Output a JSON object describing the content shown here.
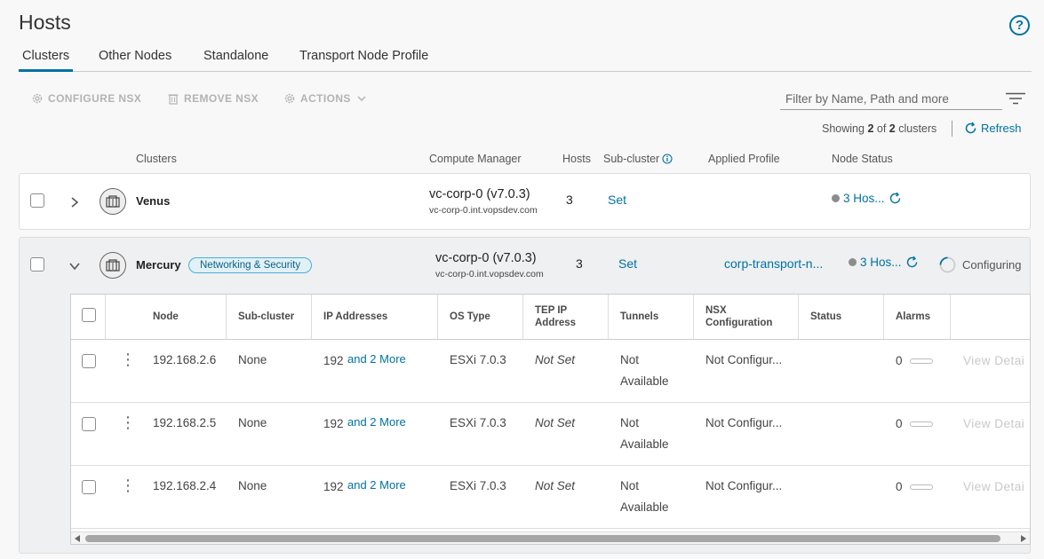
{
  "header": {
    "title": "Hosts",
    "help_label": "?"
  },
  "tabs": [
    {
      "label": "Clusters",
      "active": true
    },
    {
      "label": "Other Nodes"
    },
    {
      "label": "Standalone"
    },
    {
      "label": "Transport Node Profile"
    }
  ],
  "toolbar": {
    "configure": "CONFIGURE NSX",
    "remove": "REMOVE NSX",
    "actions": "ACTIONS"
  },
  "filter": {
    "placeholder": "Filter by Name, Path and more"
  },
  "summary": {
    "prefix": "Showing",
    "shown": "2",
    "of": "of",
    "total": "2",
    "suffix": "clusters",
    "refresh": "Refresh"
  },
  "columns": {
    "clusters": "Clusters",
    "compute_manager": "Compute Manager",
    "hosts": "Hosts",
    "sub_cluster": "Sub-cluster",
    "applied_profile": "Applied Profile",
    "node_status": "Node Status"
  },
  "clusters": [
    {
      "name": "Venus",
      "cm_name": "vc-corp-0 (v7.0.3)",
      "cm_host": "vc-corp-0.int.vopsdev.com",
      "hosts": "3",
      "sub_cluster": "Set",
      "node_status": "3 Hos..."
    },
    {
      "name": "Mercury",
      "badge": "Networking & Security",
      "cm_name": "vc-corp-0 (v7.0.3)",
      "cm_host": "vc-corp-0.int.vopsdev.com",
      "hosts": "3",
      "sub_cluster": "Set",
      "applied_profile": "corp-transport-n...",
      "node_status": "3 Hos...",
      "status": "Configuring"
    }
  ],
  "node_grid": {
    "headers": {
      "node": "Node",
      "sub_cluster": "Sub-cluster",
      "ip": "IP Addresses",
      "os": "OS Type",
      "tep_1": "TEP IP",
      "tep_2": "Address",
      "tunnels": "Tunnels",
      "nsx_1": "NSX",
      "nsx_2": "Configuration",
      "status": "Status",
      "alarms": "Alarms"
    },
    "rows": [
      {
        "node": "192.168.2.6",
        "sub_cluster": "None",
        "ip": "192",
        "ip_more": "and 2 More",
        "os": "ESXi 7.0.3",
        "tep": "Not Set",
        "tunnels_1": "Not",
        "tunnels_2": "Available",
        "nsx": "Not Configur...",
        "alarms": "0",
        "view": "View Detai"
      },
      {
        "node": "192.168.2.5",
        "sub_cluster": "None",
        "ip": "192",
        "ip_more": "and 2 More",
        "os": "ESXi 7.0.3",
        "tep": "Not Set",
        "tunnels_1": "Not",
        "tunnels_2": "Available",
        "nsx": "Not Configur...",
        "alarms": "0",
        "view": "View Detai"
      },
      {
        "node": "192.168.2.4",
        "sub_cluster": "None",
        "ip": "192",
        "ip_more": "and 2 More",
        "os": "ESXi 7.0.3",
        "tep": "Not Set",
        "tunnels_1": "Not",
        "tunnels_2": "Available",
        "nsx": "Not Configur...",
        "alarms": "0",
        "view": "View Detai"
      }
    ]
  },
  "colors": {
    "accent": "#0072a3",
    "badge_border": "#49afd9",
    "disabled": "#b3b3b3"
  }
}
